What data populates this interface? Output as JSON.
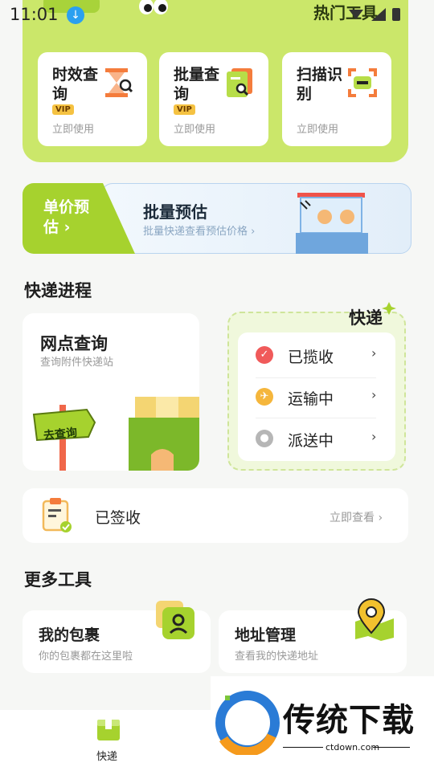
{
  "status_bar": {
    "time": "11:01"
  },
  "hot_tools": {
    "title": "热门工具",
    "cards": [
      {
        "title": "时效查询",
        "badge": "VIP",
        "action": "立即使用"
      },
      {
        "title": "批量查询",
        "badge": "VIP",
        "action": "立即使用"
      },
      {
        "title": "扫描识别",
        "action": "立即使用"
      }
    ]
  },
  "estimate": {
    "unit_price": "单价预估 ›",
    "batch_title": "批量预估",
    "batch_sub": "批量快递查看预估价格 ›"
  },
  "progress": {
    "section_title": "快递进程",
    "network": {
      "title": "网点查询",
      "sub": "查询附件快递站",
      "cta": "去查询"
    },
    "express_title": "快递",
    "statuses": [
      {
        "label": "已揽收",
        "icon": "check-circle-icon",
        "color": "#f05a5a"
      },
      {
        "label": "运输中",
        "icon": "plane-icon",
        "color": "#f5b63c"
      },
      {
        "label": "派送中",
        "icon": "courier-icon",
        "color": "#b6b6b6"
      }
    ],
    "signed": {
      "label": "已签收",
      "action": "立即查看"
    }
  },
  "more_tools": {
    "section_title": "更多工具",
    "cards": [
      {
        "title": "我的包裹",
        "sub": "你的包裹都在这里啦"
      },
      {
        "title": "地址管理",
        "sub": "查看我的快递地址"
      }
    ]
  },
  "tabbar": {
    "items": [
      {
        "label": "快递"
      }
    ]
  },
  "watermark": {
    "text": "传统下载",
    "url": "ctdown.com"
  }
}
